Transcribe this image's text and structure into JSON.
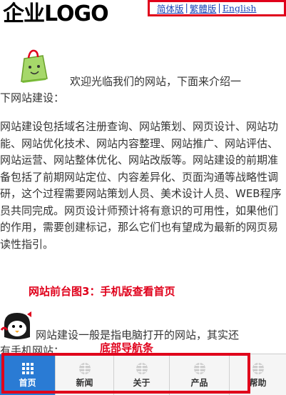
{
  "header": {
    "logo": "企业LOGO",
    "languages": [
      "简体版",
      "繁體版",
      "English"
    ]
  },
  "intro": {
    "line1": "欢迎光临我们的网站，下面来介绍一",
    "line2": "下网站建设："
  },
  "body": {
    "paragraph": "网站建设包括域名注册查询、网站策划、网页设计、网站功能、网站优化技术、网站内容整理、网站推广、网站评估、网站运营、网站整体优化、网站改版等。网站建设的前期准备包括了前期网站定位、内容差异化、页面沟通等战略性调研，这个过程需要网站策划人员、美术设计人员、WEB程序员共同完成。网页设计师预计将有意识的可用性，如果他们的作用，需要创建标记，那么它们也有望成为最新的网页易读性指引。"
  },
  "annotations": {
    "caption1": "网站前台图3：手机版查看首页",
    "caption2": "底部导航条"
  },
  "intro2": {
    "line1": "网站建设一般是指电脑打开的网站，其实还",
    "line2": "有手机网站："
  },
  "bottom_nav": {
    "items": [
      {
        "label": "首页",
        "icon": "grid-icon",
        "active": true
      },
      {
        "label": "新闻",
        "icon": "globe-icon",
        "active": false
      },
      {
        "label": "关于",
        "icon": "globe-icon",
        "active": false
      },
      {
        "label": "产品",
        "icon": "globe-icon",
        "active": false
      },
      {
        "label": "帮助",
        "icon": "globe-icon",
        "active": false
      }
    ]
  },
  "colors": {
    "accent": "#e0001b",
    "active_tab": "#2a7bd4",
    "link": "#1a44b8"
  }
}
